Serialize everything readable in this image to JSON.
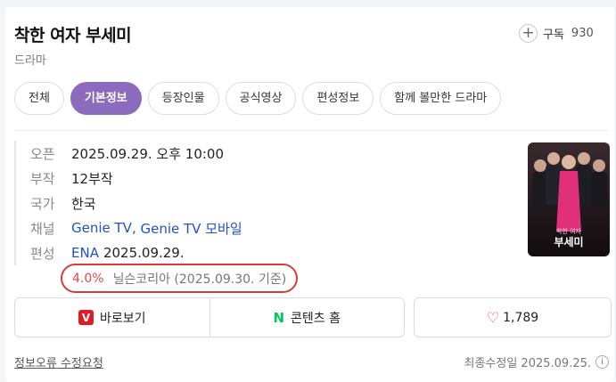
{
  "header": {
    "title": "착한 여자 부세미",
    "subtitle": "드라마",
    "subscribe_label": "구독",
    "subscribe_count": "930"
  },
  "tabs": [
    {
      "label": "전체",
      "active": false
    },
    {
      "label": "기본정보",
      "active": true
    },
    {
      "label": "등장인물",
      "active": false
    },
    {
      "label": "공식영상",
      "active": false
    },
    {
      "label": "편성정보",
      "active": false
    },
    {
      "label": "함께 볼만한 드라마",
      "active": false
    }
  ],
  "info": {
    "open_label": "오픈",
    "open_value": "2025.09.29. 오후 10:00",
    "episodes_label": "부작",
    "episodes_value": "12부작",
    "country_label": "국가",
    "country_value": "한국",
    "channel_label": "채널",
    "channel_value_1": "Genie TV",
    "channel_sep": ", ",
    "channel_value_2": "Genie TV 모바일",
    "schedule_label": "편성",
    "schedule_channel": "ENA",
    "schedule_date": "2025.09.29."
  },
  "rating": {
    "value": "4.0%",
    "source": "닐슨코리아 (2025.09.30. 기준)"
  },
  "poster": {
    "title_small": "착한 여자",
    "title_large": "부세미"
  },
  "actions": {
    "watch_label": "바로보기",
    "content_home_label": "콘텐츠 홈",
    "like_count": "1,789"
  },
  "footer": {
    "report_label": "정보오류 수정요청",
    "updated_label": "최종수정일 2025.09.25."
  },
  "colors": {
    "accent": "#8c6bbf",
    "link": "#2250c8",
    "rating_highlight": "#d93a3a"
  }
}
